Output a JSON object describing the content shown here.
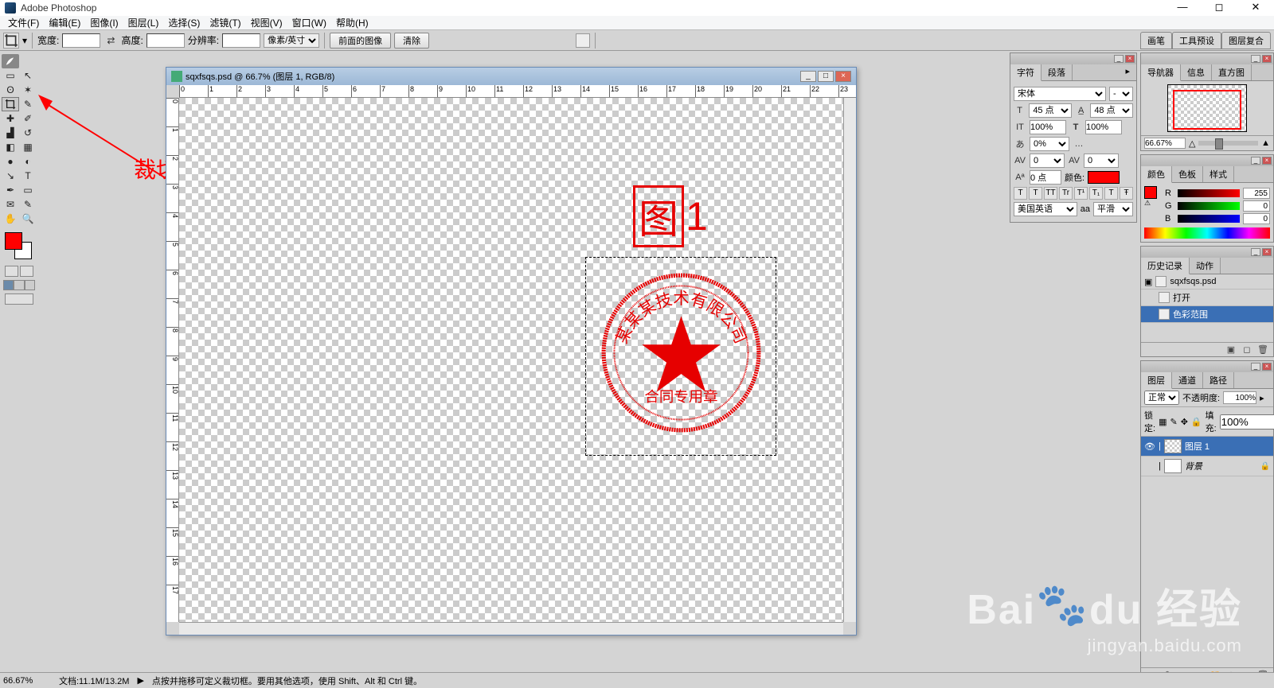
{
  "app": {
    "title": "Adobe Photoshop"
  },
  "menu": [
    "文件(F)",
    "编辑(E)",
    "图像(I)",
    "图层(L)",
    "选择(S)",
    "滤镜(T)",
    "视图(V)",
    "窗口(W)",
    "帮助(H)"
  ],
  "options": {
    "width_label": "宽度:",
    "height_label": "高度:",
    "res_label": "分辨率:",
    "unit": "像素/英寸",
    "front_image": "前面的图像",
    "clear": "清除",
    "right_tabs": [
      "画笔",
      "工具预设",
      "图层复合"
    ]
  },
  "annotation": "裁切工具",
  "doc": {
    "title": "sqxfsqs.psd @ 66.7% (图层 1, RGB/8)",
    "ruler_h": [
      0,
      1,
      2,
      3,
      4,
      5,
      6,
      7,
      8,
      9,
      10,
      11,
      12,
      13,
      14,
      15,
      16,
      17,
      18,
      19,
      20,
      21,
      22,
      23
    ],
    "ruler_v": [
      0,
      1,
      2,
      3,
      4,
      5,
      6,
      7,
      8,
      9,
      10,
      11,
      12,
      13,
      14,
      15,
      16,
      17
    ],
    "fig_label_box": "图",
    "fig_label_num": "1",
    "seal_top": "某某某技术有限公司",
    "seal_bottom": "合同专用章"
  },
  "char": {
    "tabs": [
      "字符",
      "段落"
    ],
    "font": "宋体",
    "style": "-",
    "size": "45 点",
    "leading": "48 点",
    "tracking_v": "100%",
    "tracking_h": "100%",
    "kerning": "0%",
    "kerning2": "0",
    "baseline": "0",
    "baseline2": "0",
    "shift": "0 点",
    "color_label": "颜色:",
    "buttons": [
      "T",
      "T",
      "TT",
      "Tr",
      "T¹",
      "T₁",
      "T",
      "Ŧ"
    ],
    "lang": "美国英语",
    "aa_label": "aa",
    "aa": "平滑"
  },
  "nav": {
    "tabs": [
      "导航器",
      "信息",
      "直方图"
    ],
    "zoom": "66.67%"
  },
  "color": {
    "tabs": [
      "颜色",
      "色板",
      "样式"
    ],
    "r": "255",
    "g": "0",
    "b": "0"
  },
  "history": {
    "tabs": [
      "历史记录",
      "动作"
    ],
    "doc": "sqxfsqs.psd",
    "items": [
      "打开",
      "色彩范围"
    ]
  },
  "layers": {
    "tabs": [
      "图层",
      "通道",
      "路径"
    ],
    "mode": "正常",
    "opacity_label": "不透明度:",
    "opacity": "100%",
    "lock_label": "锁定:",
    "fill_label": "填充:",
    "fill": "100%",
    "items": [
      {
        "name": "图层 1",
        "sel": true
      },
      {
        "name": "背景",
        "sel": false
      }
    ]
  },
  "status": {
    "zoom": "66.67%",
    "doc": "文档:11.1M/13.2M",
    "hint": "点按并拖移可定义裁切框。要用其他选项，使用 Shift、Alt 和 Ctrl 键。"
  },
  "watermark": {
    "big1": "Bai",
    "big2": "du",
    "big3": "经验",
    "small": "jingyan.baidu.com"
  }
}
